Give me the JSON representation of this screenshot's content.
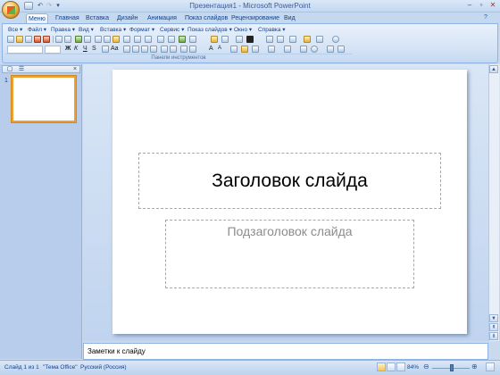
{
  "window": {
    "title": "Презентация1 - Microsoft PowerPoint"
  },
  "quick_access": [
    "save-icon",
    "undo-icon",
    "redo-icon",
    "customize-icon"
  ],
  "tabs": [
    {
      "label": "Меню",
      "active": true
    },
    {
      "label": "Главная"
    },
    {
      "label": "Вставка"
    },
    {
      "label": "Дизайн"
    },
    {
      "label": "Анимация"
    },
    {
      "label": "Показ слайдов"
    },
    {
      "label": "Рецензирование"
    },
    {
      "label": "Вид"
    }
  ],
  "menu": [
    "Все",
    "Файл",
    "Правка",
    "Вид",
    "Вставка",
    "Формат",
    "Сервис",
    "Показ слайдов",
    "Окно",
    "Справка"
  ],
  "ribbon": {
    "group_name": "Панели инструментов"
  },
  "slide": {
    "title": "Заголовок слайда",
    "subtitle": "Подзаголовок слайда",
    "number": "1"
  },
  "notes": {
    "placeholder": "Заметки к слайду"
  },
  "status": {
    "slide": "Слайд 1 из 1",
    "theme": "\"Тема Office\"",
    "language": "Русский (Россия)",
    "zoom": "84%"
  },
  "colors": {
    "ribbon": "#d3e2f5",
    "accent": "#15428b",
    "thumb_border": "#f0a030"
  }
}
